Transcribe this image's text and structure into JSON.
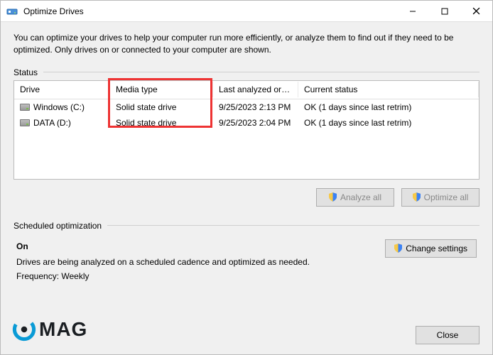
{
  "window": {
    "title": "Optimize Drives"
  },
  "description": "You can optimize your drives to help your computer run more efficiently, or analyze them to find out if they need to be optimized. Only drives on or connected to your computer are shown.",
  "status_label": "Status",
  "columns": {
    "drive": "Drive",
    "media": "Media type",
    "last": "Last analyzed or o...",
    "status": "Current status"
  },
  "drives": [
    {
      "name": "Windows (C:)",
      "media": "Solid state drive",
      "last": "9/25/2023 2:13 PM",
      "status": "OK (1 days since last retrim)"
    },
    {
      "name": "DATA (D:)",
      "media": "Solid state drive",
      "last": "9/25/2023 2:04 PM",
      "status": "OK (1 days since last retrim)"
    }
  ],
  "buttons": {
    "analyze": "Analyze all",
    "optimize": "Optimize all",
    "change": "Change settings",
    "close": "Close"
  },
  "scheduled": {
    "label": "Scheduled optimization",
    "on": "On",
    "desc": "Drives are being analyzed on a scheduled cadence and optimized as needed.",
    "freq_label": "Frequency:",
    "freq_value": "Weekly"
  },
  "logo_text": "MAG"
}
